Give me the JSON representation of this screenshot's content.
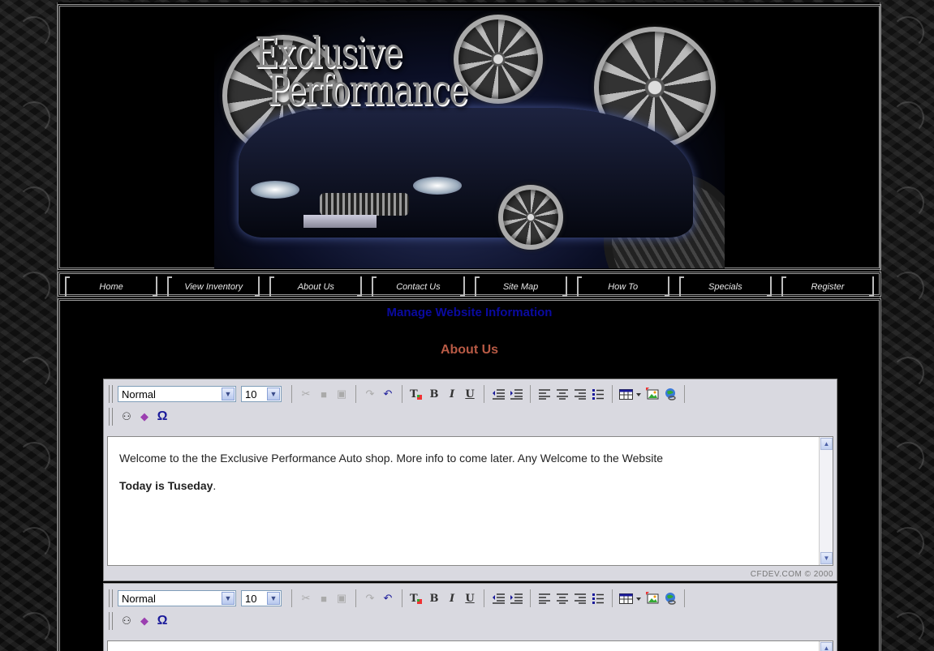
{
  "banner": {
    "logo_line1": "Exclusive",
    "logo_line2": "Performance"
  },
  "nav": {
    "items": [
      "Home",
      "View Inventory",
      "About Us",
      "Contact Us",
      "Site Map",
      "How To",
      "Specials",
      "Register"
    ]
  },
  "content": {
    "manage_title": "Manage Website Information",
    "section_title": "About Us"
  },
  "editor1": {
    "format_value": "Normal",
    "size_value": "10",
    "paragraph1": "Welcome to the the Exclusive Performance Auto shop. More info to come later. Any Welcome to the Website",
    "paragraph2_bold": "Today is Tuseday",
    "paragraph2_rest": ".",
    "credit": "CFDEV.COM © 2000"
  },
  "editor2": {
    "format_value": "Normal",
    "size_value": "10"
  },
  "icons": {
    "cut": "✂",
    "copy": "■",
    "paste": "▣",
    "redo": "↷",
    "undo": "↶",
    "find": "⚇",
    "spell": "◆",
    "omega": "Ω"
  }
}
